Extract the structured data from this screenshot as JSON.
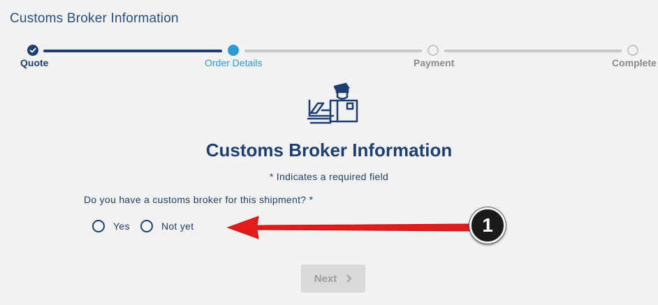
{
  "header": {
    "title": "Customs Broker Information"
  },
  "stepper": {
    "steps": [
      {
        "label": "Quote",
        "state": "done"
      },
      {
        "label": "Order Details",
        "state": "current"
      },
      {
        "label": "Payment",
        "state": "todo"
      },
      {
        "label": "Complete",
        "state": "todo"
      }
    ]
  },
  "main": {
    "icon": "customs-officer-icon",
    "title": "Customs Broker Information",
    "required_note": "* Indicates a required field",
    "question": "Do you have a customs broker for this shipment? *",
    "options": [
      {
        "label": "Yes",
        "selected": false
      },
      {
        "label": "Not yet",
        "selected": false
      }
    ],
    "next_label": "Next",
    "next_icon": "chevron-right-icon"
  },
  "annotation": {
    "number": "1",
    "arrow_color": "#e21b1b"
  },
  "colors": {
    "primary": "#1d3f72",
    "accent": "#2b9ad6",
    "inactive": "#c8c8c8"
  }
}
